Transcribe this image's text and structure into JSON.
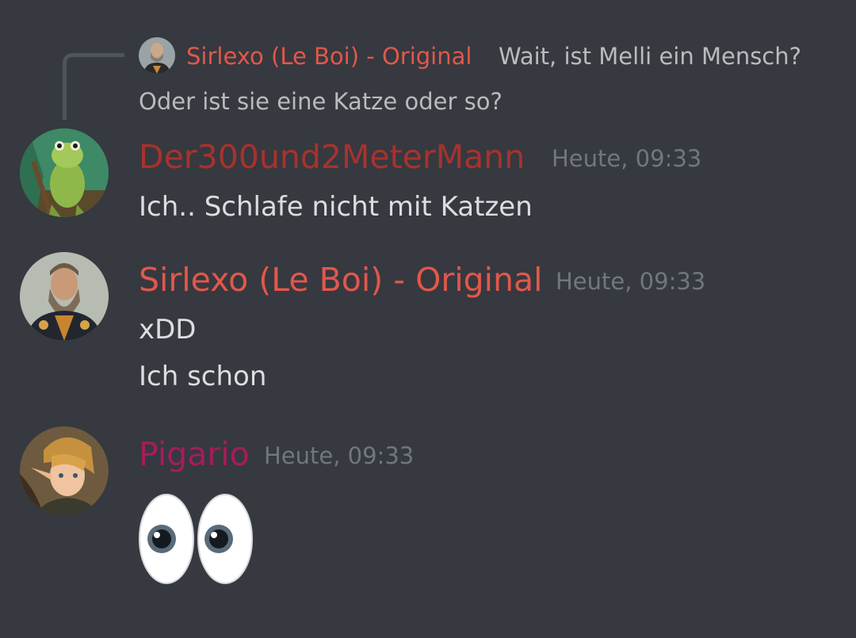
{
  "reply": {
    "author": "Sirlexo (Le Boi) - Original",
    "text_line1": "Wait, ist Melli ein Mensch?",
    "text_line2": "Oder ist sie eine Katze oder so?"
  },
  "messages": [
    {
      "author": "Der300und2MeterMann",
      "author_color": "#a8322d",
      "timestamp": "Heute, 09:33",
      "lines": [
        "Ich.. Schlafe nicht mit Katzen"
      ]
    },
    {
      "author": "Sirlexo (Le Boi) - Original",
      "author_color": "#e2574c",
      "timestamp": "Heute, 09:33",
      "lines": [
        "xDD",
        "Ich schon"
      ]
    },
    {
      "author": "Pigario",
      "author_color": "#a51d5a",
      "timestamp": "Heute, 09:33",
      "emoji": "eyes",
      "emoji_icon": "eyes-emoji-icon"
    }
  ],
  "colors": {
    "background": "#36393f",
    "text": "#dcddde",
    "muted": "#72767d",
    "reply_text": "#b9bbbe"
  }
}
